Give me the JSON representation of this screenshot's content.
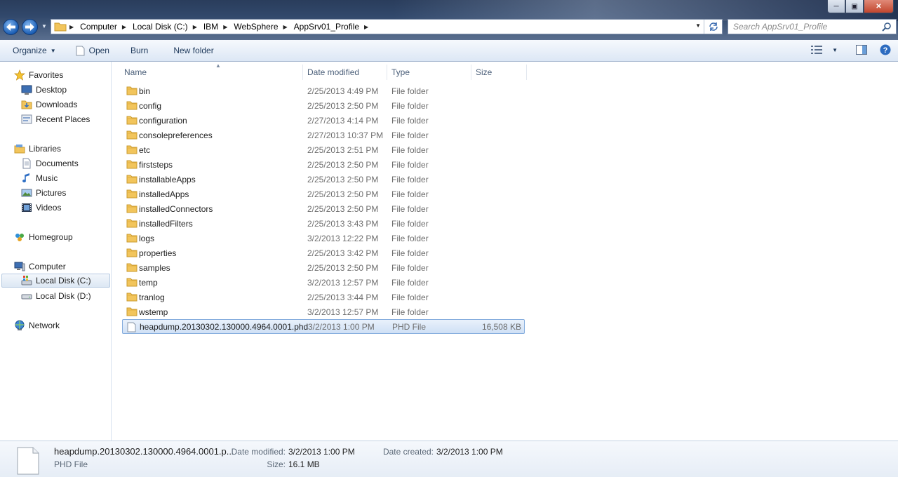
{
  "window": {
    "minimize_glyph": "─",
    "maximize_glyph": "▣",
    "close_glyph": "✕"
  },
  "address": {
    "breadcrumbs": [
      "Computer",
      "Local Disk (C:)",
      "IBM",
      "WebSphere",
      "AppSrv01_Profile"
    ]
  },
  "search": {
    "placeholder": "Search AppSrv01_Profile"
  },
  "toolbar": {
    "organize": "Organize",
    "open": "Open",
    "burn": "Burn",
    "new_folder": "New folder"
  },
  "nav": {
    "favorites": "Favorites",
    "desktop": "Desktop",
    "downloads": "Downloads",
    "recent_places": "Recent Places",
    "libraries": "Libraries",
    "documents": "Documents",
    "music": "Music",
    "pictures": "Pictures",
    "videos": "Videos",
    "homegroup": "Homegroup",
    "computer": "Computer",
    "local_disk_c": "Local Disk (C:)",
    "local_disk_d": "Local Disk (D:)",
    "network": "Network"
  },
  "columns": {
    "name": "Name",
    "date_modified": "Date modified",
    "type": "Type",
    "size": "Size"
  },
  "files": [
    {
      "name": "bin",
      "date": "2/25/2013 4:49 PM",
      "type": "File folder",
      "size": ""
    },
    {
      "name": "config",
      "date": "2/25/2013 2:50 PM",
      "type": "File folder",
      "size": ""
    },
    {
      "name": "configuration",
      "date": "2/27/2013 4:14 PM",
      "type": "File folder",
      "size": ""
    },
    {
      "name": "consolepreferences",
      "date": "2/27/2013 10:37 PM",
      "type": "File folder",
      "size": ""
    },
    {
      "name": "etc",
      "date": "2/25/2013 2:51 PM",
      "type": "File folder",
      "size": ""
    },
    {
      "name": "firststeps",
      "date": "2/25/2013 2:50 PM",
      "type": "File folder",
      "size": ""
    },
    {
      "name": "installableApps",
      "date": "2/25/2013 2:50 PM",
      "type": "File folder",
      "size": ""
    },
    {
      "name": "installedApps",
      "date": "2/25/2013 2:50 PM",
      "type": "File folder",
      "size": ""
    },
    {
      "name": "installedConnectors",
      "date": "2/25/2013 2:50 PM",
      "type": "File folder",
      "size": ""
    },
    {
      "name": "installedFilters",
      "date": "2/25/2013 3:43 PM",
      "type": "File folder",
      "size": ""
    },
    {
      "name": "logs",
      "date": "3/2/2013 12:22 PM",
      "type": "File folder",
      "size": ""
    },
    {
      "name": "properties",
      "date": "2/25/2013 3:42 PM",
      "type": "File folder",
      "size": ""
    },
    {
      "name": "samples",
      "date": "2/25/2013 2:50 PM",
      "type": "File folder",
      "size": ""
    },
    {
      "name": "temp",
      "date": "3/2/2013 12:57 PM",
      "type": "File folder",
      "size": ""
    },
    {
      "name": "tranlog",
      "date": "2/25/2013 3:44 PM",
      "type": "File folder",
      "size": ""
    },
    {
      "name": "wstemp",
      "date": "3/2/2013 12:57 PM",
      "type": "File folder",
      "size": ""
    },
    {
      "name": "heapdump.20130302.130000.4964.0001.phd",
      "date": "3/2/2013 1:00 PM",
      "type": "PHD File",
      "size": "16,508 KB"
    }
  ],
  "details": {
    "file_name": "heapdump.20130302.130000.4964.0001.p...",
    "file_type": "PHD File",
    "date_modified_label": "Date modified:",
    "date_modified": "3/2/2013 1:00 PM",
    "date_created_label": "Date created:",
    "date_created": "3/2/2013 1:00 PM",
    "size_label": "Size:",
    "size": "16.1 MB"
  },
  "colors": {
    "selection_bg": "#cfe0f5",
    "selection_border": "#84acdd",
    "folder_yellow": "#f2c55c"
  }
}
